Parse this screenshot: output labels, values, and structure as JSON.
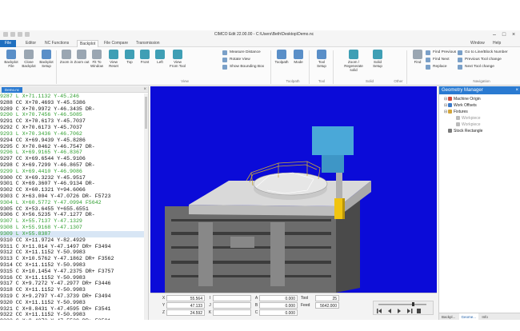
{
  "window": {
    "title": "CIMCO Edit 22.00.00 - C:\\Users\\Beth\\Desktop\\Demo.nc",
    "window_menu": "Window",
    "help_menu": "Help",
    "minimize": "–",
    "maximize": "□",
    "close": "×"
  },
  "tabs": [
    "File",
    "Editor",
    "NC Functions",
    "Backplot",
    "File Compare",
    "Transmission"
  ],
  "ribbon": {
    "buttons": [
      {
        "label": "Backplot File"
      },
      {
        "label": "Close Backplot"
      },
      {
        "label": "Backplot Setup"
      },
      {
        "label": "Zoom in"
      },
      {
        "label": "Zoom out"
      },
      {
        "label": "Fit To Window"
      },
      {
        "label": "View Reset"
      },
      {
        "label": "Top"
      },
      {
        "label": "Front"
      },
      {
        "label": "Left"
      },
      {
        "label": "View From Tool"
      },
      {
        "label": "Toolpath"
      },
      {
        "label": "Mode"
      },
      {
        "label": "Tool Setup"
      },
      {
        "label": "Zoom / Regenerate solid"
      },
      {
        "label": "Solid Setup"
      },
      {
        "label": "Find"
      }
    ],
    "small_buttons": [
      "Measure Distance",
      "Rotate View",
      "Show Bounding Box",
      "Find Previous",
      "Find Next",
      "Replace",
      "Go to Line/Block Number",
      "Previous Tool change",
      "Next Tool change"
    ],
    "groups": [
      "View",
      "Toolpath",
      "Tool",
      "Solid",
      "Other",
      "Navigation"
    ]
  },
  "editor": {
    "tab_label": "Demo.nc",
    "close": "×",
    "current_index": 22,
    "lines": [
      {
        "text": "9287 L X+71.1132 Y-45.246",
        "green": true
      },
      {
        "text": "9288 CC X+70.4693 Y-45.5386",
        "green": false
      },
      {
        "text": "9289 C X+70.9972 Y-46.3435 DR-",
        "green": false
      },
      {
        "text": "9290 L X+70.7456 Y-46.5085",
        "green": true
      },
      {
        "text": "9291 CC X+70.6173 Y-45.7037",
        "green": false
      },
      {
        "text": "9292 C X+70.6173 Y-45.7037",
        "green": false
      },
      {
        "text": "9293 L X+70.3436 Y-46.7062",
        "green": true
      },
      {
        "text": "9294 CC X+69.9439 Y-45.8286",
        "green": false
      },
      {
        "text": "9295 C X+70.0462 Y-46.7547 DR-",
        "green": false
      },
      {
        "text": "9296 L X+69.9165 Y-46.8367",
        "green": true
      },
      {
        "text": "9297 CC X+69.6544 Y-45.9106",
        "green": false
      },
      {
        "text": "9298 C X+69.7299 Y-46.8657 DR-",
        "green": false
      },
      {
        "text": "9299 L X+69.4410 Y-46.9086",
        "green": true
      },
      {
        "text": "9300 CC X+69.3232 Y-45.9517",
        "green": false
      },
      {
        "text": "9301 C X+69.3607 Y-46.9134 DR-",
        "green": false
      },
      {
        "text": "9302 CC X+60.1321 Y+94.6066",
        "green": false
      },
      {
        "text": "9303 C X+63.004 Y-47.0726 DR- F5723",
        "green": false
      },
      {
        "text": "9304 L X+60.5772 Y-47.0994 F5642",
        "green": true
      },
      {
        "text": "9305 CC X+53.6455 Y+655.6551",
        "green": false
      },
      {
        "text": "9306 C X+56.5235 Y-47.1277 DR-",
        "green": false
      },
      {
        "text": "9307 L X+55.7137 Y-47.1329",
        "green": true
      },
      {
        "text": "9308 L X+55.9168 Y-47.1307",
        "green": true
      },
      {
        "text": "9309 L X+55.8387",
        "green": true
      },
      {
        "text": "9310 CC X+11.9724 Y-82.4929",
        "green": false
      },
      {
        "text": "9311 C X+11.014 Y-47.1497 DR+ F3494",
        "green": false
      },
      {
        "text": "9312 CC X+11.1152 Y-50.9983",
        "green": false
      },
      {
        "text": "9313 C X+10.5762 Y-47.1862 DR+ F3562",
        "green": false
      },
      {
        "text": "9314 CC X+11.1152 Y-50.9983",
        "green": false
      },
      {
        "text": "9315 C X+10.1454 Y-47.2375 DR+ F3757",
        "green": false
      },
      {
        "text": "9316 CC X+11.1152 Y-50.9983",
        "green": false
      },
      {
        "text": "9317 C X+9.7272 Y-47.2977 DR+ F3446",
        "green": false
      },
      {
        "text": "9318 CC X+11.1152 Y-50.9983",
        "green": false
      },
      {
        "text": "9319 C X+9.2797 Y-47.3739 DR+ F3494",
        "green": false
      },
      {
        "text": "9320 CC X+11.1152 Y-50.9983",
        "green": false
      },
      {
        "text": "9321 C X+8.8431 Y-47.4595 DR+ F3541",
        "green": false
      },
      {
        "text": "9322 CC X+11.1152 Y-50.9983",
        "green": false
      },
      {
        "text": "9323 C X+8.4073 Y-47.5539 DR+ F3591",
        "green": false
      }
    ]
  },
  "dro": {
    "x_label": "X",
    "x_value": "55.564",
    "y_label": "Y",
    "y_value": "47.133",
    "z_label": "Z",
    "z_value": "24.592",
    "a_label": "A",
    "a_value": "0.000",
    "b_label": "B",
    "b_value": "0.000",
    "c_label": "C",
    "c_value": "0.000",
    "i_label": "I",
    "j_label": "J",
    "k_label": "K",
    "tool_label": "Tool",
    "tool_value": "25",
    "feed_label": "Feed",
    "feed_value": "5642.000"
  },
  "geometry": {
    "title": "Geometry Manager",
    "close": "×",
    "items": [
      {
        "label": "Machine Origin",
        "dim": false,
        "toggle": "⊟",
        "color": "#d14a3a"
      },
      {
        "label": "Work Offsets",
        "dim": false,
        "toggle": "⊟",
        "color": "#3a79c9"
      },
      {
        "label": "Fixtures",
        "dim": false,
        "toggle": "⊟",
        "color": "#d3a53a"
      },
      {
        "label": "Workpiece",
        "dim": true,
        "toggle": "",
        "color": "#bbbbbb"
      },
      {
        "label": "Workpiece",
        "dim": true,
        "toggle": "",
        "color": "#bbbbbb"
      },
      {
        "label": "Stock Rectangle",
        "dim": false,
        "toggle": "",
        "color": "#7a7a7a"
      }
    ],
    "bottom_tabs": [
      "Backpl...",
      "Geome...",
      "Info"
    ]
  },
  "colors": {
    "viewport_bg": "#0b0bd8",
    "accent": "#2a7ad1",
    "tool_cyan": "#4aa8d8",
    "tool_yellow": "#f1c40f",
    "toolpath_green": "#2f9e2f"
  }
}
